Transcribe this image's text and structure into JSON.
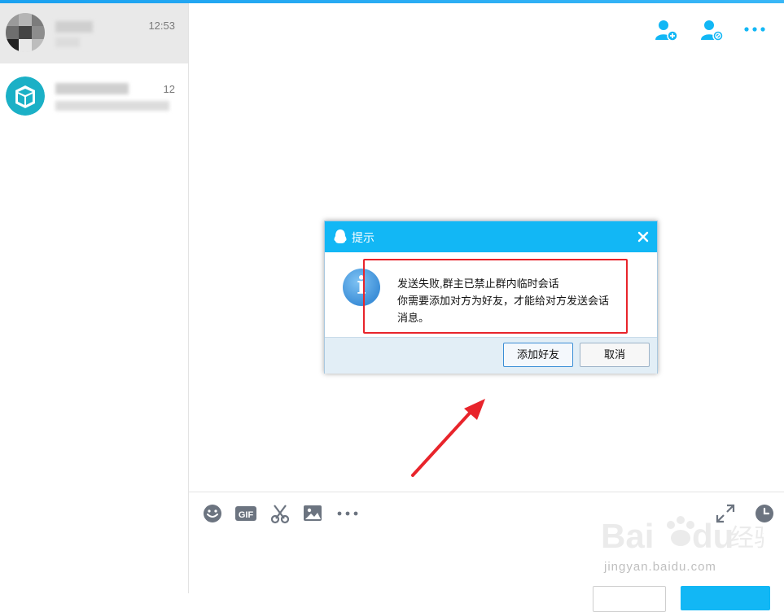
{
  "conversations": [
    {
      "time": "12:53"
    },
    {
      "time": "12"
    }
  ],
  "dialog": {
    "title": "提示",
    "message_line1": "发送失败,群主已禁止群内临时会话",
    "message_line2": "你需要添加对方为好友，才能给对方发送会话",
    "message_line3": "消息。",
    "add_friend_label": "添加好友",
    "cancel_label": "取消"
  },
  "watermark": {
    "line2": "jingyan.baidu.com"
  },
  "colors": {
    "accent": "#12b7f5",
    "highlight": "#e8242b"
  }
}
